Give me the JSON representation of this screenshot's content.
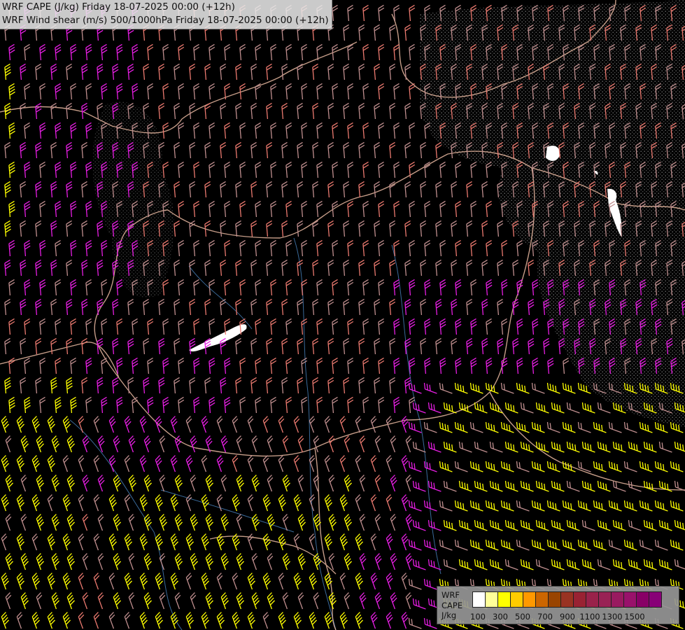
{
  "title": {
    "line1": "WRF CAPE (J/kg) Friday 18-07-2025 00:00 (+12h)",
    "line2": "WRF Wind shear (m/s) 500/1000hPa Friday 18-07-2025 00:00 (+12h)"
  },
  "legend": {
    "label1": "WRF",
    "label2": "CAPE",
    "label3": "J/kg",
    "colors": [
      "#ffffff",
      "#ffff99",
      "#ffff00",
      "#ffcc00",
      "#ff9900",
      "#cc6600",
      "#994400",
      "#993322",
      "#992233",
      "#99224a",
      "#992255",
      "#991a60",
      "#99116b",
      "#880066",
      "#880077"
    ],
    "ticks": [
      {
        "label": "100",
        "index": 0
      },
      {
        "label": "300",
        "index": 2
      },
      {
        "label": "500",
        "index": 4
      },
      {
        "label": "700",
        "index": 6
      },
      {
        "label": "900",
        "index": 8
      },
      {
        "label": "1100",
        "index": 10
      },
      {
        "label": "1300",
        "index": 12
      },
      {
        "label": "1500",
        "index": 14
      }
    ]
  },
  "barb_colors": {
    "weak": "#c08f8f",
    "moderate": "#ec7a70",
    "strong": "#e81ee4",
    "very_strong": "#ffff00"
  }
}
